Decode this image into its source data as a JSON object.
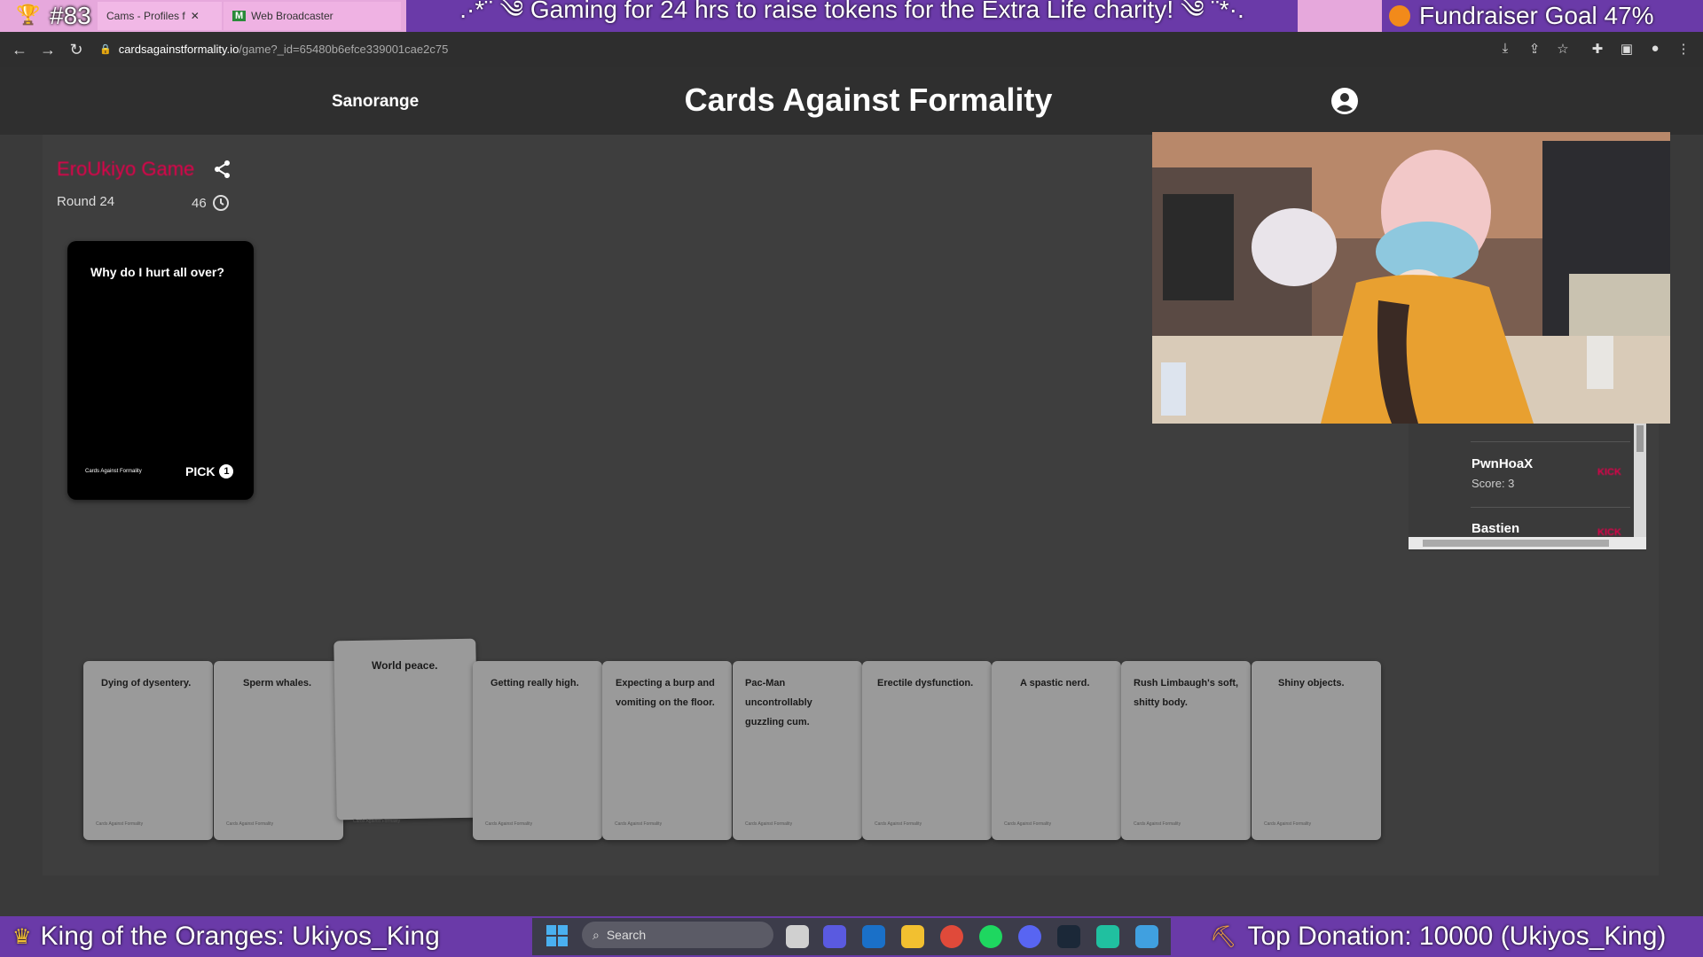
{
  "overlay": {
    "rank": "#83",
    "banner": ".·*¨ ༄ Gaming for 24 hrs to raise tokens for the Extra Life charity! ༄ ¨*·.",
    "goal": "Fundraiser Goal 47%",
    "bottom_left": "King of the Oranges: Ukiyos_King",
    "bottom_right": "Top Donation:  10000 (Ukiyos_King)"
  },
  "browser": {
    "tabs": [
      {
        "label": "Cams - Profiles f"
      },
      {
        "label": "Web Broadcaster"
      }
    ],
    "url_host": "cardsagainstformality.io",
    "url_path": "/game?_id=65480b6efce339001cae2c75"
  },
  "site": {
    "username": "Sanorange",
    "title": "Cards Against Formality"
  },
  "game": {
    "name": "EroUkiyo Game",
    "round": "Round 24",
    "timer": "46",
    "black_card": {
      "text": "Why do I hurt all over?",
      "brand": "Cards Against Formality",
      "pick_label": "PICK",
      "pick_count": "1"
    },
    "players": [
      {
        "name": "PwnHoaX",
        "score": "Score: 3",
        "kick": "KICK"
      },
      {
        "name": "Bastien",
        "kick": "KICK"
      }
    ],
    "hand": [
      {
        "text": "Dying of dysentery."
      },
      {
        "text": "Sperm whales."
      },
      {
        "text": "World peace."
      },
      {
        "text": "Getting really high."
      },
      {
        "text": "Expecting a burp and vomiting on the floor."
      },
      {
        "text": "Pac-Man uncontrollably guzzling cum."
      },
      {
        "text": "Erectile dysfunction."
      },
      {
        "text": "A spastic nerd."
      },
      {
        "text": "Rush Limbaugh's soft, shitty body."
      },
      {
        "text": "Shiny objects."
      }
    ],
    "card_brand": "Cards Against Formality"
  },
  "taskbar": {
    "search": "Search"
  },
  "colors": {
    "accent": "#e4004b",
    "overlay_purple": "#6a3aa8",
    "tab_pink": "#e6a8dc"
  }
}
